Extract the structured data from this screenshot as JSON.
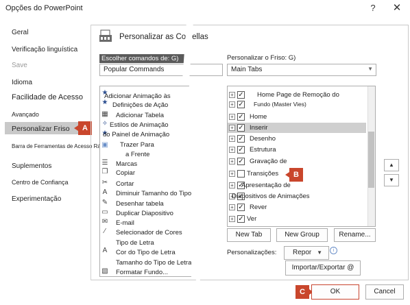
{
  "window": {
    "title": "Opções do PowerPoint",
    "help_glyph": "?",
    "close_glyph": "✕"
  },
  "nav": {
    "items": [
      {
        "label": "Geral"
      },
      {
        "label": "Verificação linguística"
      },
      {
        "label": "Save"
      },
      {
        "label": "Idioma"
      },
      {
        "label": "Facilidade de Acesso"
      },
      {
        "label": "Avançado"
      },
      {
        "label": "Personalizar Friso"
      },
      {
        "label": "Barra de Ferramentas de Acesso Rápido"
      },
      {
        "label": "Suplementos"
      },
      {
        "label": "Centro de Confiança"
      },
      {
        "label": "Experimentação"
      }
    ],
    "selected_index": 6
  },
  "header": {
    "title": "Personalizar as Costellas",
    "icon": "ribbon-customize-icon"
  },
  "left_panel": {
    "label": "Escolher comandos de: G)",
    "select_value": "Popular Commands",
    "commands": [
      {
        "label": "Adicionar Animação às",
        "icon": "star-animation-icon"
      },
      {
        "label": "Definições de Ação",
        "icon": "star-animation-icon"
      },
      {
        "label": "Adicionar Tabela",
        "icon": "table-icon"
      },
      {
        "label": "Estilos de Animação",
        "icon": "animation-styles-icon"
      },
      {
        "label": "do Painel de Animação",
        "icon": "animation-pane-icon"
      },
      {
        "label": "Trazer Para",
        "icon": "bring-forward-icon"
      },
      {
        "label": "a Frente",
        "icon": ""
      },
      {
        "label": "Marcas",
        "icon": "bullets-icon"
      },
      {
        "label": "Copiar",
        "icon": "copy-icon"
      },
      {
        "label": "Cortar",
        "icon": "cut-icon"
      },
      {
        "label": "Diminuir Tamanho do Tipo de Letra",
        "icon": "decrease-font-icon"
      },
      {
        "label": "Desenhar tabela",
        "icon": "draw-table-icon"
      },
      {
        "label": "Duplicar Diapositivo",
        "icon": "duplicate-slide-icon"
      },
      {
        "label": "E-mail",
        "icon": "email-icon"
      },
      {
        "label": "Selecionador de Cores",
        "icon": "eyedropper-icon"
      },
      {
        "label": "Tipo de Letra",
        "icon": "font-icon"
      },
      {
        "label": "Cor do Tipo de Letra",
        "icon": "font-color-icon"
      },
      {
        "label": "Tamanho do Tipo de Letra",
        "icon": "font-size-icon"
      },
      {
        "label": "Formatar Fundo...",
        "icon": "format-background-icon"
      }
    ]
  },
  "right_panel": {
    "label": "Personalizar o Friso: G)",
    "select_value": "Main Tabs",
    "tabs": [
      {
        "label": "Home Page de Remoção do",
        "checked": true,
        "expander": "⊞"
      },
      {
        "label": "Fundo (Master Vies)",
        "checked": true,
        "expander": "⊞"
      },
      {
        "label": "Home",
        "checked": true,
        "expander": "⊞"
      },
      {
        "label": "Inserir",
        "checked": true,
        "expander": "⊞"
      },
      {
        "label": "Desenho",
        "checked": true,
        "expander": "⊞"
      },
      {
        "label": "Estrutura",
        "checked": true,
        "expander": "⊞"
      },
      {
        "label": "Gravação de",
        "checked": true,
        "expander": "⊞"
      },
      {
        "label": "Transições",
        "checked": false,
        "expander": "⊞"
      },
      {
        "label": "Apresentação de",
        "checked": true,
        "expander": "⊞"
      },
      {
        "label": "Diapositivos de Animações",
        "checked": true,
        "expander": "⊞"
      },
      {
        "label": "Rever",
        "checked": true,
        "expander": "⊞"
      },
      {
        "label": "Ver",
        "checked": true,
        "expander": "⊞"
      }
    ],
    "selected_index": 3,
    "move_up_glyph": "▲",
    "move_down_glyph": "▼"
  },
  "buttons": {
    "new_tab": "New Tab",
    "new_group": "New Group",
    "rename": "Rename...",
    "customizations_label": "Personalizações:",
    "reset": "Repor",
    "reset_caret": "▼",
    "info_glyph": "i",
    "import_export": "Importar/Exportar @",
    "ok": "OK",
    "cancel": "Cancel"
  },
  "callouts": {
    "a": "A",
    "b": "B",
    "c": "C",
    "color": "#c9462c"
  },
  "colors": {
    "selected_nav": "#c9c9c9",
    "accent_ok_border": "#c7432e",
    "label_dark_bg": "#5b5b5b"
  }
}
